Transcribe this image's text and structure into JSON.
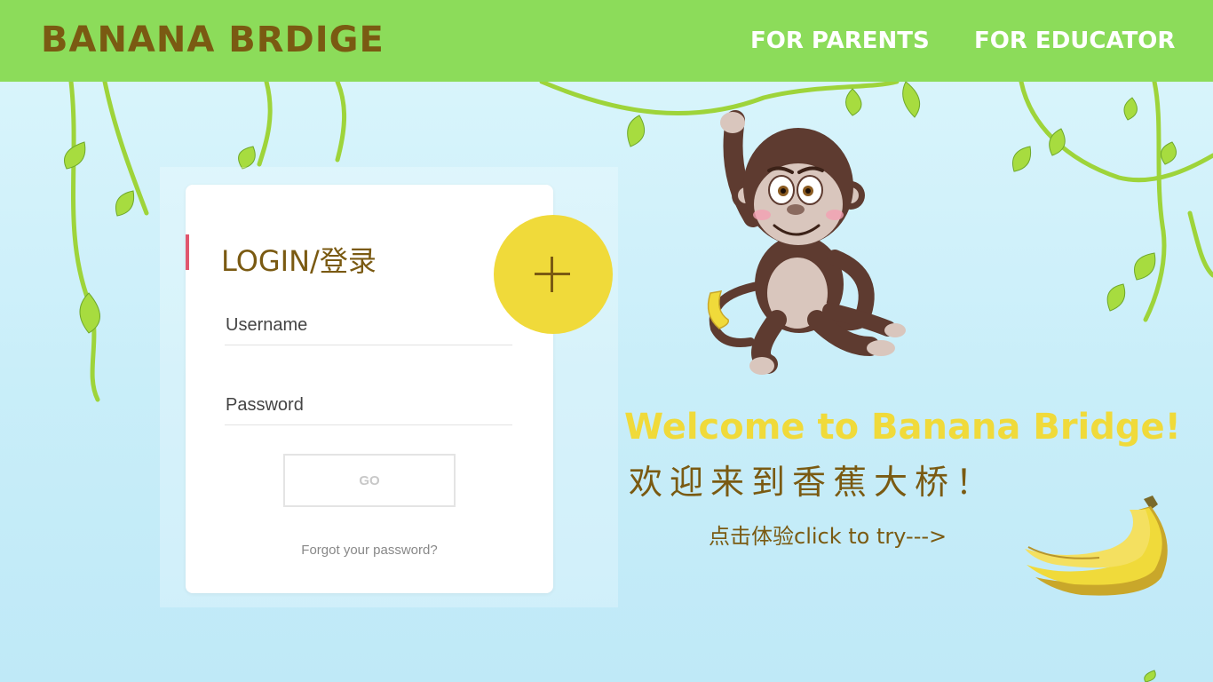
{
  "header": {
    "brand": "BANANA BRDIGE",
    "nav": {
      "parents": "FOR PARENTS",
      "educator": "FOR EDUCATOR"
    }
  },
  "login": {
    "title": "LOGIN/登录",
    "username_placeholder": "Username",
    "password_placeholder": "Password",
    "go_label": "GO",
    "forgot_label": "Forgot your password?"
  },
  "welcome": {
    "english": "Welcome to Banana Bridge!",
    "chinese": "欢迎来到香蕉大桥！",
    "try": "点击体验click to try--->"
  },
  "colors": {
    "header_bg": "#8cdc5a",
    "brand_text": "#7a5a12",
    "accent_yellow": "#f0da3a",
    "card_accent": "#e0566e",
    "vine_green": "#9ed43a"
  },
  "icons": {
    "plus": "plus-icon",
    "monkey": "monkey-illustration",
    "bananas": "banana-bunch-icon"
  }
}
